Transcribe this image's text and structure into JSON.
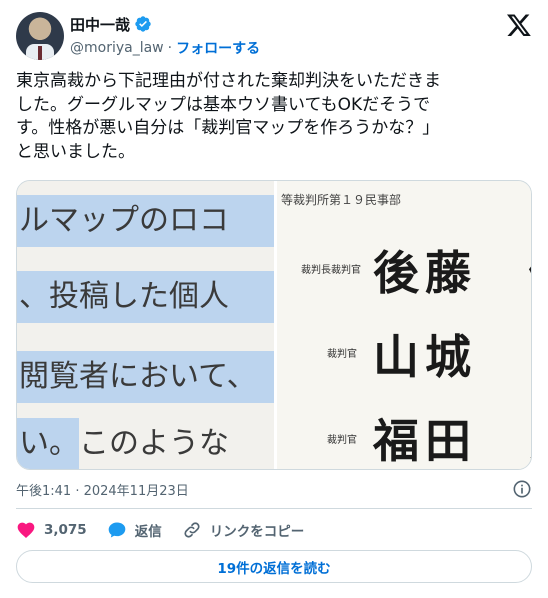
{
  "author": {
    "name": "田中一哉",
    "handle": "@moriya_law",
    "separator": "·",
    "follow_label": "フォローする"
  },
  "tweet": {
    "text": "東京高裁から下記理由が付された棄却判決をいただきま\nした。グーグルマップは基本ウソ書いてもOKだそうで\nす。性格が悪い自分は「裁判官マップを作ろうかな？」\nと思いました。",
    "timestamp": "午後1:41 · 2024年11月23日"
  },
  "media": {
    "left_lines": [
      "ルマップのロコ",
      "、投稿した個人",
      "閲覧者において、",
      "い。このような"
    ],
    "right": {
      "court_title": "等裁判所第１９民事部",
      "judges": [
        {
          "label": "裁判長裁判官",
          "name": "後藤　優"
        },
        {
          "label": "裁判官",
          "name": "山城　司"
        },
        {
          "label": "裁判官",
          "name": "福田　亮"
        }
      ]
    }
  },
  "actions": {
    "likes_count": "3,075",
    "reply_label": "返信",
    "copy_link_label": "リンクをコピー"
  },
  "read_replies_label": "19件の返信を読む",
  "colors": {
    "link_blue": "#006fd6",
    "like_pink": "#f91880",
    "reply_blue": "#1d9bf0",
    "secondary_text": "#536471",
    "highlight": "#bcd4ee"
  },
  "icons": {
    "verified": "verified-badge-icon",
    "logo": "x-logo-icon",
    "info": "info-icon",
    "like": "heart-icon",
    "reply": "speech-bubble-icon",
    "copy_link": "link-icon"
  }
}
